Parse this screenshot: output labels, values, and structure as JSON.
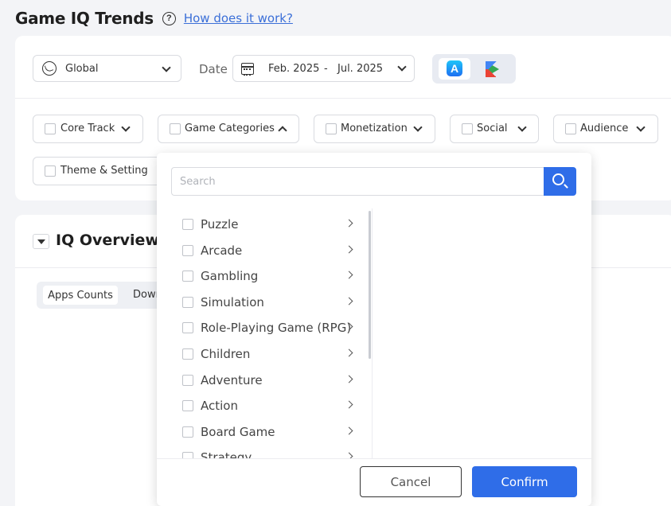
{
  "header": {
    "title": "Game IQ Trends",
    "help_icon": "question-circle-icon",
    "help_link": "How does it work?"
  },
  "filters": {
    "region": "Global",
    "date_label": "Date",
    "date_start": "Feb. 2025",
    "date_separator": "-",
    "date_end": "Jul. 2025",
    "stores": [
      "app-store-icon",
      "google-play-icon"
    ],
    "active_store": "app-store-icon",
    "chips": [
      {
        "label": "Core Track"
      },
      {
        "label": "Game Categories"
      },
      {
        "label": "Monetization"
      },
      {
        "label": "Social"
      },
      {
        "label": "Audience"
      },
      {
        "label": "Theme & Setting"
      }
    ]
  },
  "overview": {
    "title": "IQ Overview",
    "tabs": [
      "Apps Counts",
      "Down"
    ]
  },
  "dropdown": {
    "search_placeholder": "Search",
    "categories": [
      "Puzzle",
      "Arcade",
      "Gambling",
      "Simulation",
      "Role-Playing Game (RPG)",
      "Children",
      "Adventure",
      "Action",
      "Board Game",
      "Strategy"
    ],
    "cancel": "Cancel",
    "confirm": "Confirm"
  },
  "colors": {
    "accent": "#2f6de8",
    "link": "#3b6fd8",
    "background": "#f3f4f7"
  }
}
